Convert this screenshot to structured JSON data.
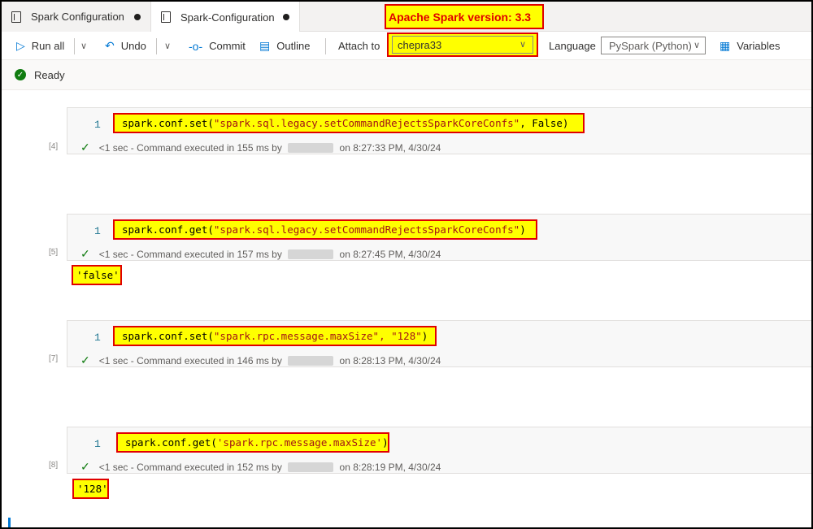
{
  "tabs": [
    {
      "label": "Spark Configuration",
      "unsaved": true
    },
    {
      "label": "Spark-Configuration",
      "unsaved": true,
      "active": true
    }
  ],
  "callout": "Apache Spark version: 3.3",
  "toolbar": {
    "run_all": "Run all",
    "undo": "Undo",
    "commit": "Commit",
    "outline": "Outline",
    "attach_label": "Attach to",
    "attach_value": "chepra33",
    "language_label": "Language",
    "language_value": "PySpark (Python)",
    "variables": "Variables"
  },
  "status": {
    "text": "Ready"
  },
  "cells": [
    {
      "exec_count": "[4]",
      "line": "1",
      "code_fn": "spark.conf.set(",
      "code_args": "\"spark.sql.legacy.setCommandRejectsSparkCoreConfs\"",
      "code_tail": ", False)",
      "duration": "<1 sec",
      "exec_prefix": " - Command executed in 155 ms by ",
      "exec_suffix": " on 8:27:33 PM, 4/30/24",
      "output": ""
    },
    {
      "exec_count": "[5]",
      "line": "1",
      "code_fn": "spark.conf.get(",
      "code_args": "\"spark.sql.legacy.setCommandRejectsSparkCoreConfs\"",
      "code_tail": ")",
      "duration": "<1 sec",
      "exec_prefix": " - Command executed in 157 ms by ",
      "exec_suffix": " on 8:27:45 PM, 4/30/24",
      "output": "'false'"
    },
    {
      "exec_count": "[7]",
      "line": "1",
      "code_fn": "spark.conf.set(",
      "code_args": "\"spark.rpc.message.maxSize\", \"128\"",
      "code_tail": ")",
      "duration": "<1 sec",
      "exec_prefix": " - Command executed in 146 ms by ",
      "exec_suffix": " on 8:28:13 PM, 4/30/24",
      "output": ""
    },
    {
      "exec_count": "[8]",
      "line": "1",
      "code_fn": "spark.conf.get(",
      "code_args": "'spark.rpc.message.maxSize'",
      "code_tail": ")",
      "duration": "<1 sec",
      "exec_prefix": " - Command executed in 152 ms by ",
      "exec_suffix": " on 8:28:19 PM, 4/30/24",
      "output": "'128'"
    }
  ],
  "colors": {
    "highlight": "#ffff00",
    "callout_border": "#e00000",
    "accent": "#0078d4",
    "success": "#107c10"
  }
}
